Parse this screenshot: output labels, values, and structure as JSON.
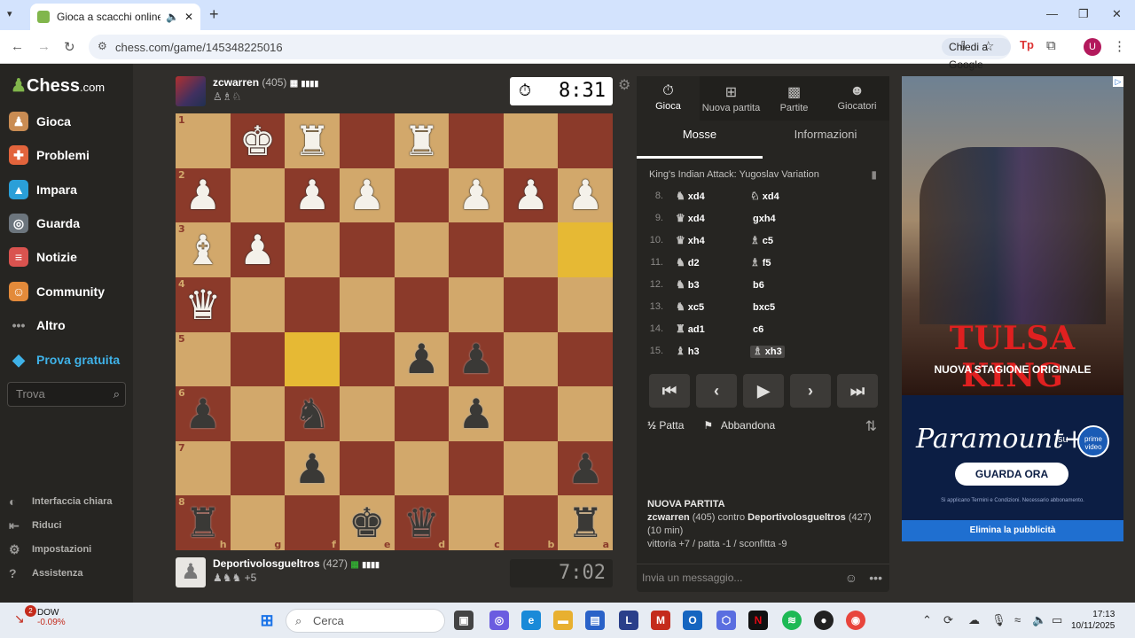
{
  "browser": {
    "tab_title": "Gioca a scacchi online GRAT",
    "url": "chess.com/game/145348225016",
    "ask_google": "Chiedi a Google",
    "profile_initial": "U"
  },
  "sidebar": {
    "logo_text": "Chess",
    "logo_suffix": ".com",
    "items": [
      {
        "label": "Gioca",
        "icon": "pawn-icon",
        "color": "#c98c53"
      },
      {
        "label": "Problemi",
        "icon": "puzzle-icon",
        "color": "#e2643c"
      },
      {
        "label": "Impara",
        "icon": "graduation-icon",
        "color": "#2a9fd8"
      },
      {
        "label": "Guarda",
        "icon": "binoculars-icon",
        "color": "#9aa3ad"
      },
      {
        "label": "Notizie",
        "icon": "news-icon",
        "color": "#d9534f"
      },
      {
        "label": "Community",
        "icon": "community-icon",
        "color": "#e38a3a"
      },
      {
        "label": "Altro",
        "icon": "more-icon",
        "color": "#9a9997"
      },
      {
        "label": "Prova gratuita",
        "icon": "diamond-icon",
        "color": "#3fb2e8"
      }
    ],
    "search_placeholder": "Trova",
    "bottom": [
      {
        "label": "Interfaccia chiara",
        "icon": "half-circle-icon"
      },
      {
        "label": "Riduci",
        "icon": "collapse-icon"
      },
      {
        "label": "Impostazioni",
        "icon": "gear-icon"
      },
      {
        "label": "Assistenza",
        "icon": "help-icon"
      }
    ]
  },
  "top_player": {
    "name": "zcwarren",
    "rating": "(405)",
    "flag": "US",
    "captured": "♙♗♘",
    "clock": "8:31"
  },
  "bottom_player": {
    "name": "Deportivolosgueltros",
    "rating": "(427)",
    "flag": "IT",
    "captured": "♟♞♞",
    "advantage": "+5",
    "clock": "7:02"
  },
  "board": {
    "orientation": "black",
    "rank_labels": [
      "1",
      "2",
      "3",
      "4",
      "5",
      "6",
      "7",
      "8"
    ],
    "file_labels": [
      "h",
      "g",
      "f",
      "e",
      "d",
      "c",
      "b",
      "a"
    ],
    "highlighted": [
      "a3",
      "f5"
    ],
    "rows": [
      [
        "",
        "K",
        "R",
        "",
        "R",
        "",
        "",
        ""
      ],
      [
        "P",
        "",
        "P",
        "P",
        "",
        "P",
        "P",
        "P"
      ],
      [
        "B",
        "P",
        "",
        "",
        "",
        "",
        "",
        ""
      ],
      [
        "Q",
        "",
        "",
        "",
        "",
        "",
        "",
        ""
      ],
      [
        "",
        "",
        "",
        "",
        "p",
        "p",
        "",
        ""
      ],
      [
        "p",
        "",
        "n",
        "",
        "",
        "p",
        "",
        ""
      ],
      [
        "",
        "",
        "p",
        "",
        "",
        "",
        "",
        "p"
      ],
      [
        "r",
        "",
        "",
        "k",
        "q",
        "",
        "",
        "r"
      ]
    ]
  },
  "panel": {
    "tabs": [
      {
        "label": "Gioca",
        "icon": "stopwatch-icon"
      },
      {
        "label": "Nuova partita",
        "icon": "plus-square-icon"
      },
      {
        "label": "Partite",
        "icon": "board-icon"
      },
      {
        "label": "Giocatori",
        "icon": "players-icon"
      }
    ],
    "subtabs": [
      "Mosse",
      "Informazioni"
    ],
    "opening": "King's Indian Attack: Yugoslav Variation",
    "moves": [
      {
        "n": "8.",
        "w_pc": "♞",
        "w": "xd4",
        "b_pc": "♘",
        "b": "xd4"
      },
      {
        "n": "9.",
        "w_pc": "♛",
        "w": "xd4",
        "b_pc": "",
        "b": "gxh4"
      },
      {
        "n": "10.",
        "w_pc": "♛",
        "w": "xh4",
        "b_pc": "♗",
        "b": "c5"
      },
      {
        "n": "11.",
        "w_pc": "♞",
        "w": "d2",
        "b_pc": "♗",
        "b": "f5"
      },
      {
        "n": "12.",
        "w_pc": "♞",
        "w": "b3",
        "b_pc": "",
        "b": "b6"
      },
      {
        "n": "13.",
        "w_pc": "♞",
        "w": "xc5",
        "b_pc": "",
        "b": "bxc5"
      },
      {
        "n": "14.",
        "w_pc": "♜",
        "w": "ad1",
        "b_pc": "",
        "b": "c6"
      },
      {
        "n": "15.",
        "w_pc": "♝",
        "w": "h3",
        "b_pc": "♗",
        "b": "xh3"
      }
    ],
    "controls": [
      "⏮",
      "‹",
      "▶",
      "›",
      "⏭"
    ],
    "draw": "Patta",
    "draw_icon": "½",
    "resign": "Abbandona",
    "info": {
      "heading": "NUOVA PARTITA",
      "white": "zcwarren",
      "white_rating": "(405)",
      "vs": "contro",
      "black": "Deportivolosgueltros",
      "black_rating": "(427)",
      "time": "(10 min)",
      "result": "vittoria +7 / patta -1 / sconfitta -9"
    },
    "chat_placeholder": "Invia un messaggio..."
  },
  "ad": {
    "title": "TULSA KING",
    "subtitle": "NUOVA STAGIONE ORIGINALE",
    "brand": "Paramount+",
    "su": "su",
    "prime": "prime video",
    "cta": "GUARDA ORA",
    "terms": "Si applicano Termini e Condizioni. Necessario abbonamento.",
    "remove": "Elimina la pubblicità"
  },
  "taskbar": {
    "ticker": "DOW",
    "ticker_value": "-0.09%",
    "ticker_badge": "2",
    "search": "Cerca",
    "time": "17:13",
    "date": "10/11/2025"
  }
}
